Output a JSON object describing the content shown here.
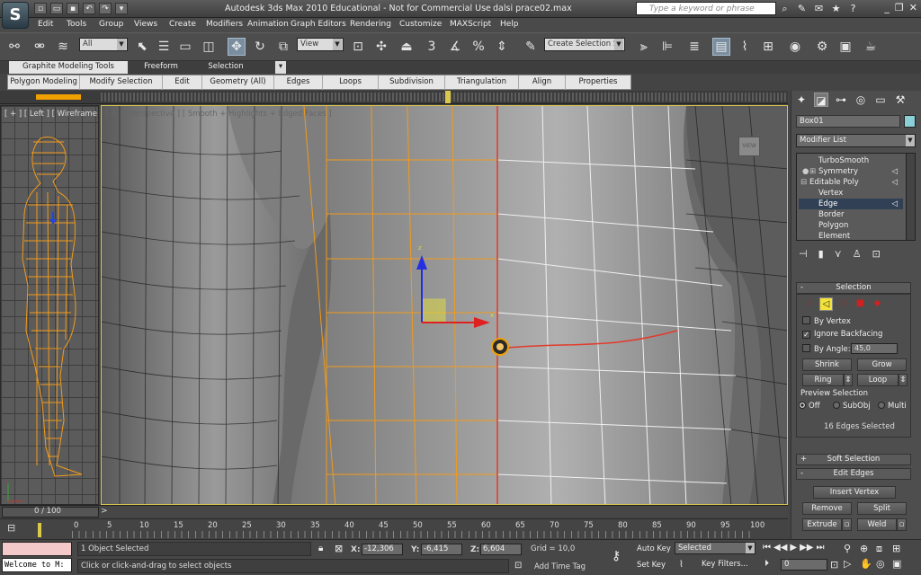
{
  "window": {
    "title": "Autodesk 3ds Max  2010   Educational - Not for Commercial Use",
    "file": "dalsi prace02.max",
    "search_placeholder": "Type a keyword or phrase",
    "minimize": "_",
    "restore": "❐",
    "close": "✕"
  },
  "menu": [
    "Edit",
    "Tools",
    "Group",
    "Views",
    "Create",
    "Modifiers",
    "Animation",
    "Graph Editors",
    "Rendering",
    "Customize",
    "MAXScript",
    "Help"
  ],
  "toolbar": {
    "selection_filter": "All",
    "ref_coord": "View",
    "named_selection": "Create Selection Se"
  },
  "graphite_tabs": [
    "Graphite Modeling Tools",
    "Freeform",
    "Selection"
  ],
  "ribbon_tabs": [
    "Polygon Modeling",
    "Modify Selection",
    "Edit",
    "Geometry (All)",
    "Edges",
    "Loops",
    "Subdivision",
    "Triangulation",
    "Align",
    "Properties"
  ],
  "viewport_left": {
    "label": "[ + ] [ Left ] [ Wireframe ]"
  },
  "viewport_main": {
    "label": "[ + ] [ Perspective ] [ Smooth + Highlights + Edged Faces ]"
  },
  "command_panel": {
    "object_name": "Box01",
    "object_color": "#8ad0d6",
    "modifier_list": "Modifier List",
    "stack": [
      {
        "label": "TurboSmooth",
        "indent": 1
      },
      {
        "label": "Symmetry",
        "indent": 1
      },
      {
        "label": "Editable Poly",
        "indent": 1
      },
      {
        "label": "Vertex",
        "indent": 2
      },
      {
        "label": "Edge",
        "indent": 2,
        "selected": true
      },
      {
        "label": "Border",
        "indent": 2
      },
      {
        "label": "Polygon",
        "indent": 2
      },
      {
        "label": "Element",
        "indent": 2
      }
    ],
    "selection_rollout": "Selection",
    "by_vertex": "By Vertex",
    "ignore_backfacing": "Ignore Backfacing",
    "by_angle": "By Angle:",
    "by_angle_value": "45,0",
    "shrink": "Shrink",
    "grow": "Grow",
    "ring": "Ring",
    "loop": "Loop",
    "preview_selection": "Preview Selection",
    "preview_off": "Off",
    "preview_subobj": "SubObj",
    "preview_multi": "Multi",
    "edges_selected": "16 Edges Selected",
    "soft_selection": "Soft Selection",
    "edit_edges": "Edit Edges",
    "insert_vertex": "Insert Vertex",
    "remove": "Remove",
    "split": "Split",
    "extrude": "Extrude",
    "weld": "Weld"
  },
  "timeline": {
    "frame_text": "0 / 100",
    "ticks": [
      "0",
      "5",
      "10",
      "15",
      "20",
      "25",
      "30",
      "35",
      "40",
      "45",
      "50",
      "55",
      "60",
      "65",
      "70",
      "75",
      "80",
      "85",
      "90",
      "95",
      "100"
    ]
  },
  "status": {
    "listener": "Welcome to M:",
    "selected_text": "1 Object Selected",
    "prompt": "Click or click-and-drag to select objects",
    "x_label": "X:",
    "x_value": "-12,306",
    "y_label": "Y:",
    "y_value": "-6,415",
    "z_label": "Z:",
    "z_value": "6,604",
    "grid": "Grid = 10,0",
    "add_time_tag": "Add Time Tag",
    "auto_key": "Auto Key",
    "set_key": "Set Key",
    "key_mode": "Selected",
    "key_filters": "Key Filters...",
    "current_frame": "0"
  }
}
